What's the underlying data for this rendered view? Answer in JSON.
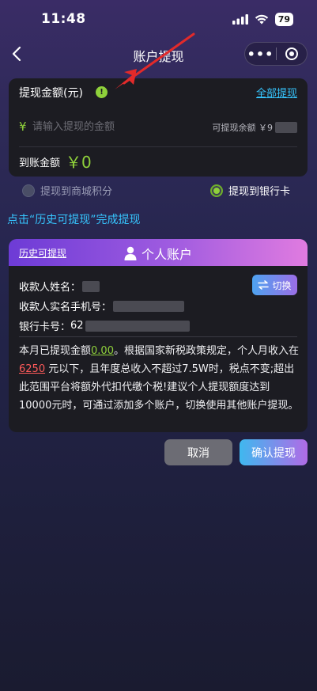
{
  "status": {
    "time": "11:48",
    "battery": "79"
  },
  "nav": {
    "title": "账户提现"
  },
  "withdraw": {
    "amount_label": "提现金额(元)",
    "info_icon_text": "!",
    "withdraw_all_label": "全部提现",
    "currency_symbol": "¥",
    "amount_placeholder": "请输入提现的金额",
    "balance_label": "可提现余额 ￥9",
    "arrive_label": "到账金额",
    "arrive_value": "￥0"
  },
  "options": [
    {
      "label": "提现到商城积分",
      "selected": false
    },
    {
      "label": "提现到银行卡",
      "selected": true
    }
  ],
  "hint": "点击“历史可提现”完成提现",
  "account": {
    "history_link": "历史可提现",
    "title": "个人账户",
    "switch_label": "切换",
    "payee_name_label": "收款人姓名：",
    "payee_phone_label": "收款人实名手机号：",
    "bank_card_label": "银行卡号：",
    "bank_card_prefix": "62",
    "notice": {
      "p1": "本月已提现金额",
      "withdrawn": "0.00",
      "p2": "。根据国家新税政策规定，个人月收入在",
      "limit": "6250",
      "p3": "元以下，且年度总收入不超过7.5W时，税点不变;超出此范围平台将额外代扣代缴个税!建议个人提现额度达到10000元时，可通过添加多个账户，切换使用其他账户提现。"
    }
  },
  "buttons": {
    "cancel": "取消",
    "confirm": "确认提现"
  },
  "colors": {
    "green": "#8fd13b",
    "blue_link": "#36c6ff",
    "red": "#ff5a5a"
  }
}
